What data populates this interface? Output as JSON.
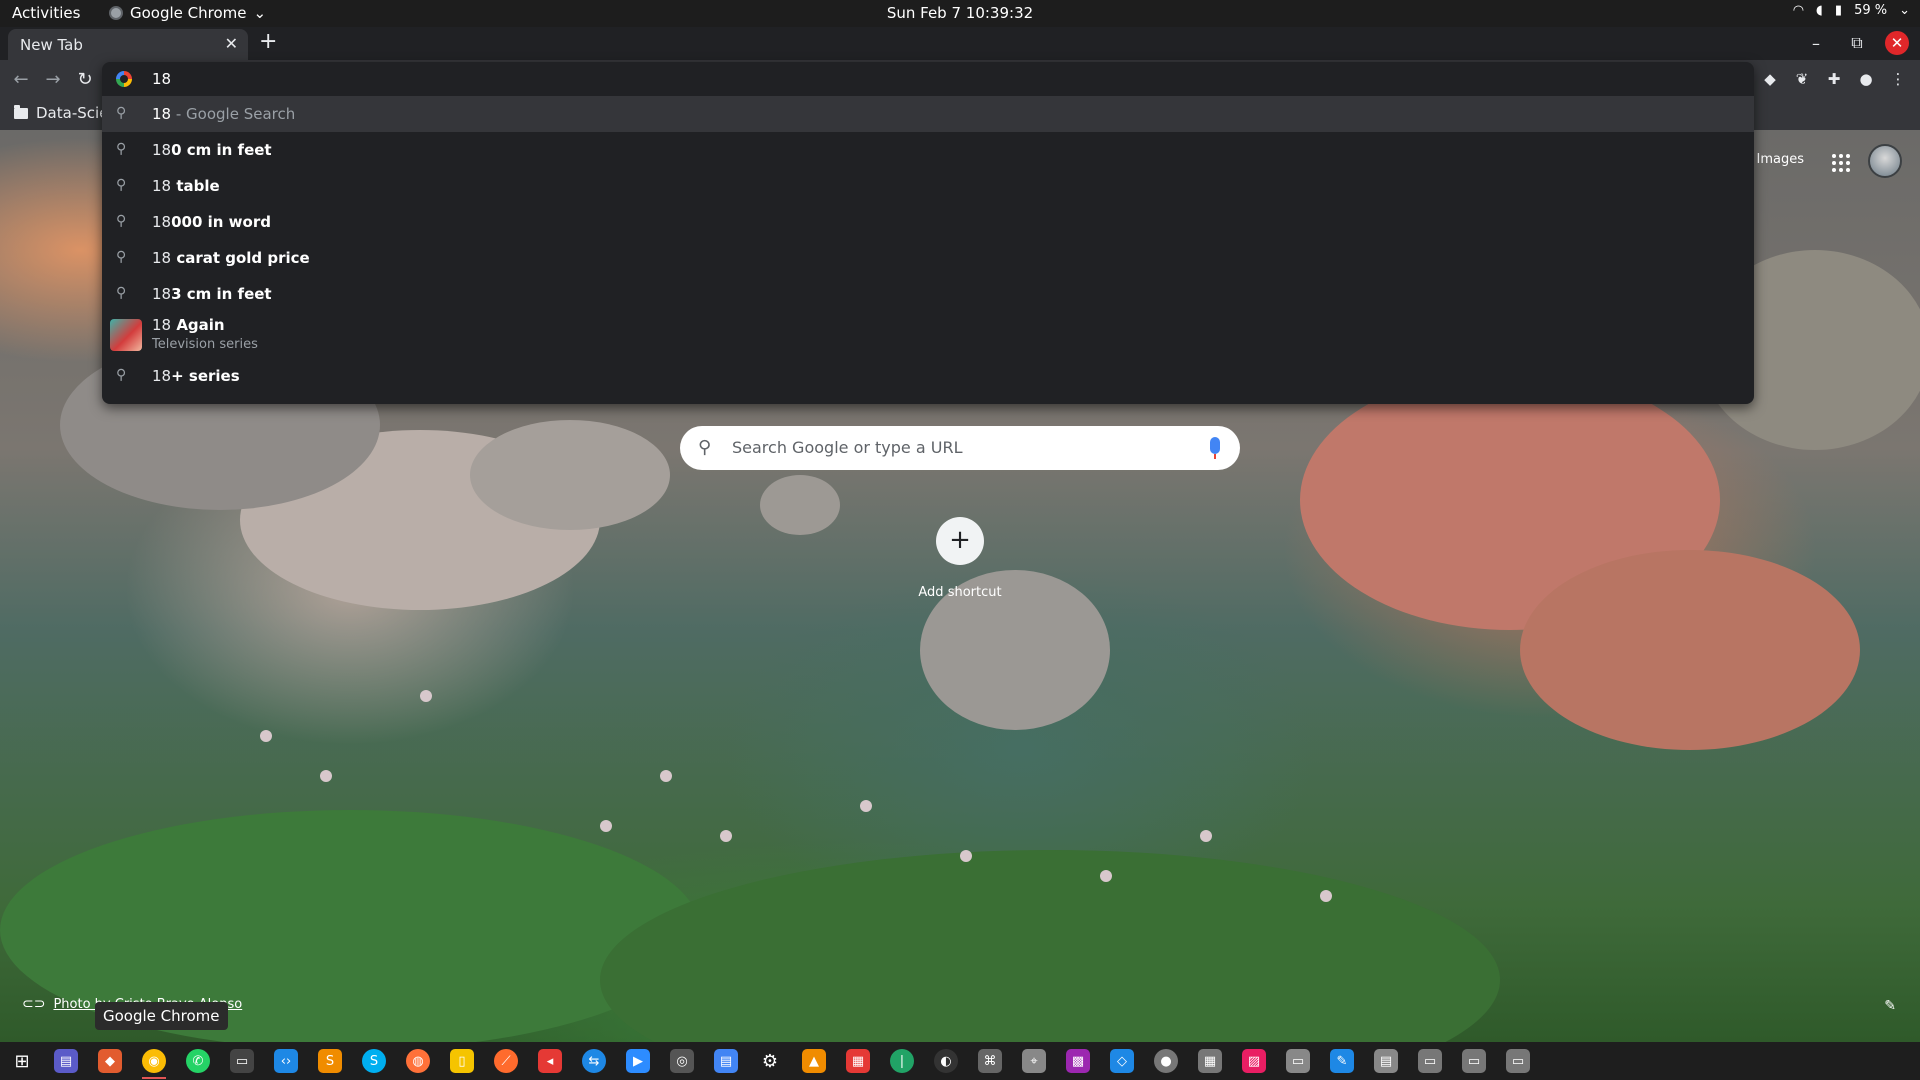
{
  "topbar": {
    "activities": "Activities",
    "app_name": "Google Chrome",
    "clock": "Sun Feb 7  10:39:32",
    "battery": "59 %"
  },
  "tab": {
    "title": "New Tab"
  },
  "bookmarks": {
    "items": [
      {
        "label": "Data-Scie"
      }
    ]
  },
  "omnibox": {
    "query": "18",
    "suggestions": [
      {
        "bold": "18",
        "rest": " - Google Search",
        "selected": true
      },
      {
        "prefix": "18",
        "bold": "0 cm in feet"
      },
      {
        "prefix": "18",
        "bold": " table"
      },
      {
        "prefix": "18",
        "bold": "000 in word"
      },
      {
        "prefix": "18",
        "bold": " carat gold price"
      },
      {
        "prefix": "18",
        "bold": "3 cm in feet"
      },
      {
        "prefix": "18",
        "bold": " Again",
        "subtitle": "Television series"
      },
      {
        "prefix": "18",
        "bold": "+ series"
      }
    ]
  },
  "ntp": {
    "images_link": "Images",
    "search_placeholder": "Search Google or type a URL",
    "add_shortcut_label": "Add shortcut",
    "photo_credit": "Photo by Cristo Bravo Alonso",
    "tooltip": "Google Chrome"
  },
  "colors": {
    "chrome_dark": "#202124",
    "toolbar": "#35363a",
    "close_red": "#e0272a",
    "accent_blue": "#4285f4"
  }
}
